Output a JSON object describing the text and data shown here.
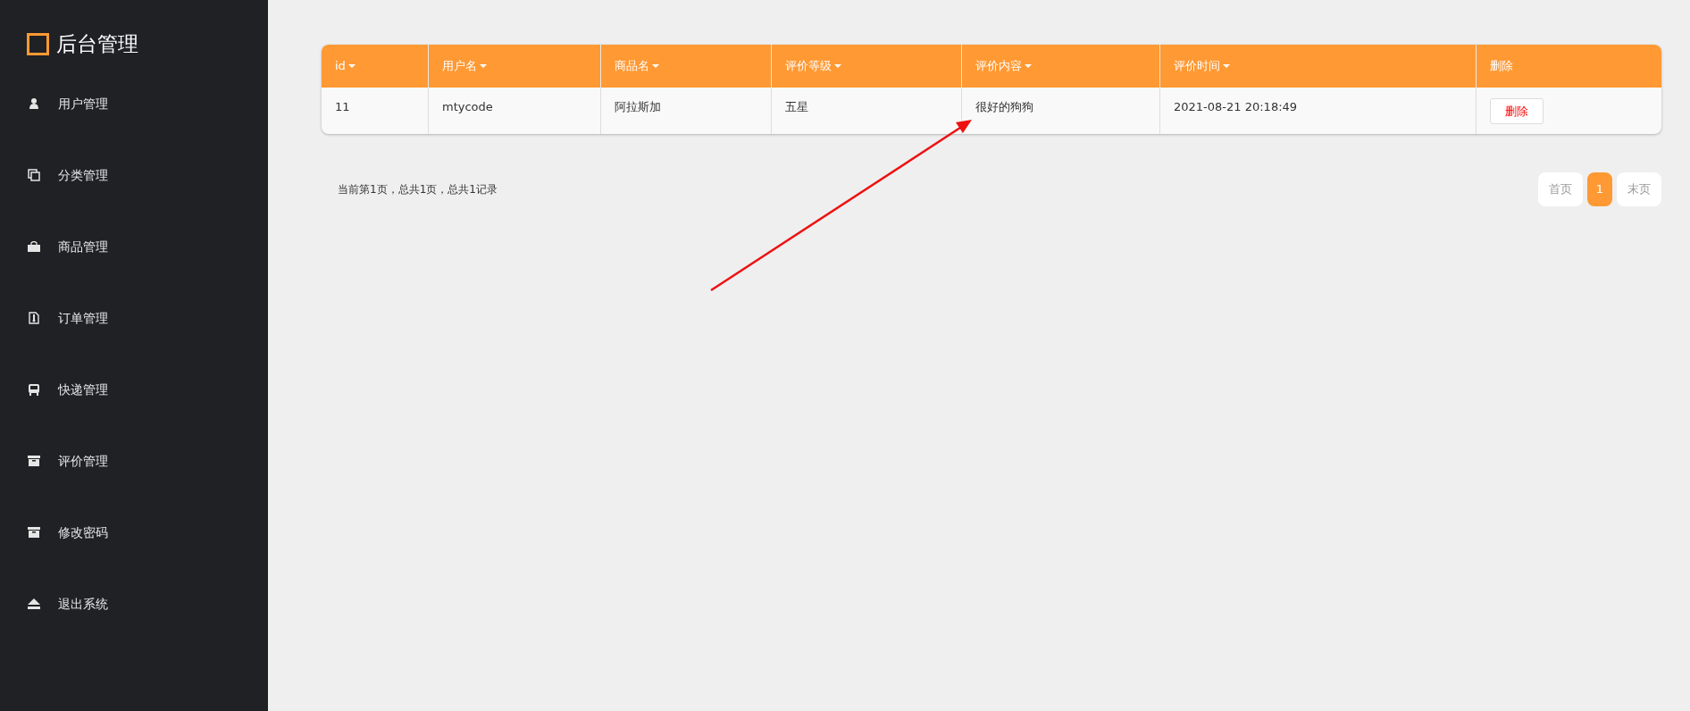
{
  "sidebar": {
    "logo": "后台管理",
    "items": [
      {
        "label": "用户管理",
        "kind": "user"
      },
      {
        "label": "分类管理",
        "kind": "category"
      },
      {
        "label": "商品管理",
        "kind": "goods"
      },
      {
        "label": "订单管理",
        "kind": "order"
      },
      {
        "label": "快递管理",
        "kind": "delivery"
      },
      {
        "label": "评价管理",
        "kind": "review"
      },
      {
        "label": "修改密码",
        "kind": "password"
      },
      {
        "label": "退出系统",
        "kind": "logout"
      }
    ]
  },
  "table": {
    "columns": [
      {
        "label": "id",
        "sortable": true
      },
      {
        "label": "用户名",
        "sortable": true
      },
      {
        "label": "商品名",
        "sortable": true
      },
      {
        "label": "评价等级",
        "sortable": true
      },
      {
        "label": "评价内容",
        "sortable": true
      },
      {
        "label": "评价时间",
        "sortable": true
      },
      {
        "label": "删除",
        "sortable": false
      }
    ],
    "rows": [
      {
        "cells": [
          "11",
          "mtycode",
          "阿拉斯加",
          "五星",
          "很好的狗狗",
          "2021-08-21 20:18:49"
        ],
        "action": "删除"
      }
    ]
  },
  "pagination": {
    "summary": "当前第1页，总共1页，总共1记录",
    "first": "首页",
    "pages": [
      {
        "label": "1",
        "selected": true
      }
    ],
    "last": "末页"
  }
}
